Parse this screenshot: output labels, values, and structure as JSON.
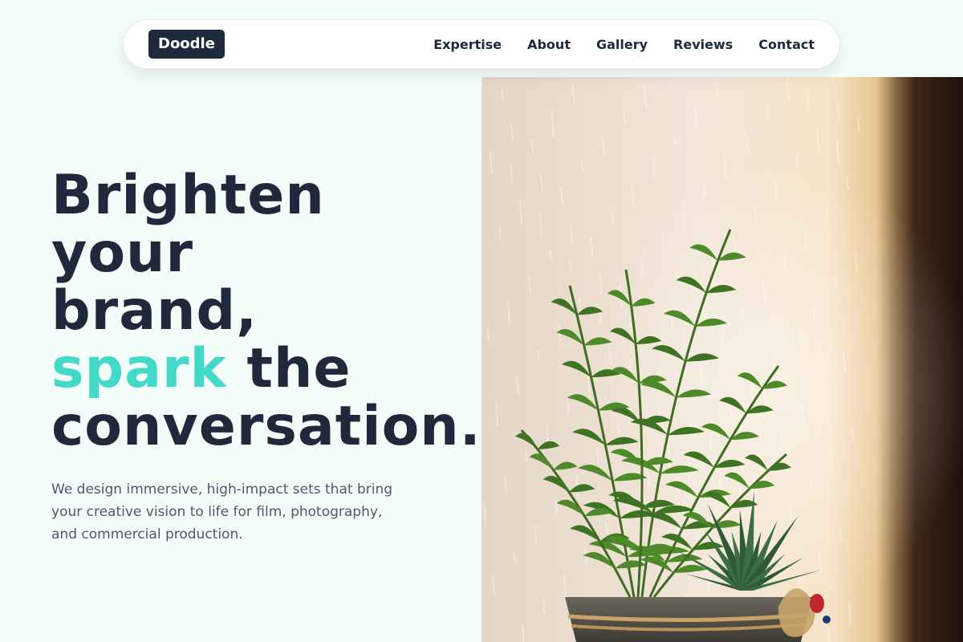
{
  "nav": {
    "logo": "Doodle",
    "links": [
      "Expertise",
      "About",
      "Gallery",
      "Reviews",
      "Contact"
    ]
  },
  "hero": {
    "title_line1": "Brighten",
    "title_line2": "your",
    "title_line3": "brand,",
    "title_accent": "spark",
    "title_line4_rest": " the",
    "title_line5": "conversation.",
    "subtitle": "We design immersive, high-impact sets that bring your creative vision to life for film, photography, and commercial production."
  },
  "image": {
    "subject": "potted palm and succulent plant"
  },
  "colors": {
    "background": "#f3fdf9",
    "text_dark": "#1e293b",
    "accent": "#43d9c8",
    "text_muted": "#4a5a6e"
  }
}
